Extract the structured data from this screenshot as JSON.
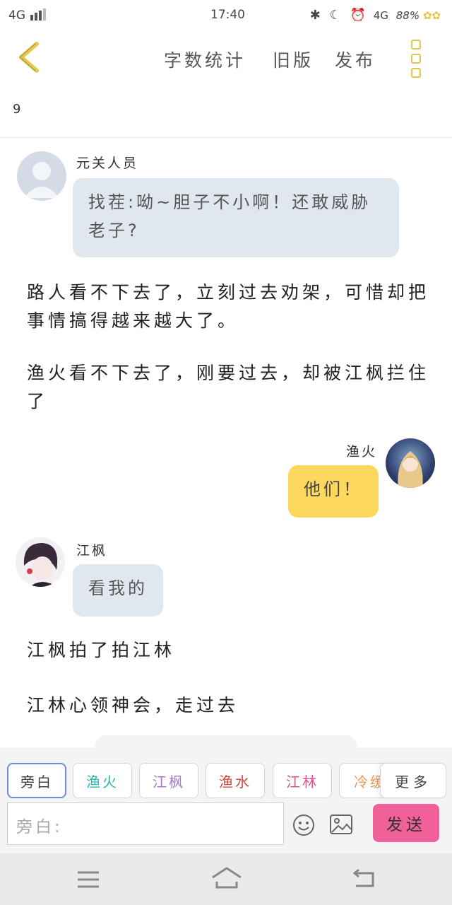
{
  "status_bar": {
    "network": "4G",
    "time": "17:40",
    "right_network": "4G",
    "battery": "88%"
  },
  "nav": {
    "links": [
      "字数统计",
      "旧版",
      "发布"
    ]
  },
  "word_count": "9",
  "messages": [
    {
      "type": "left",
      "name": "元关人员",
      "text": "找茬:呦~胆子不小啊！还敢威胁老子?"
    },
    {
      "type": "narration",
      "text": "路人看不下去了，立刻过去劝架，可惜却把事情搞得越来越大了。"
    },
    {
      "type": "narration",
      "text": "渔火看不下去了，刚要过去，却被江枫拦住了"
    },
    {
      "type": "right",
      "name": "渔火",
      "text": "他们！"
    },
    {
      "type": "left",
      "name": "江枫",
      "text": "看我的"
    },
    {
      "type": "narration",
      "text": "江枫拍了拍江林"
    },
    {
      "type": "narration",
      "text": "江林心领神会，走过去"
    }
  ],
  "characters": [
    {
      "label": "旁白",
      "color": "#555555"
    },
    {
      "label": "渔火",
      "color": "#2bb5b0"
    },
    {
      "label": "江枫",
      "color": "#a875d6"
    },
    {
      "label": "渔水",
      "color": "#d24a3a"
    },
    {
      "label": "江林",
      "color": "#e0508a"
    },
    {
      "label": "冷缓",
      "color": "#e39a5a"
    }
  ],
  "more_label": "更多",
  "input_placeholder": "旁白:",
  "send_label": "发送"
}
